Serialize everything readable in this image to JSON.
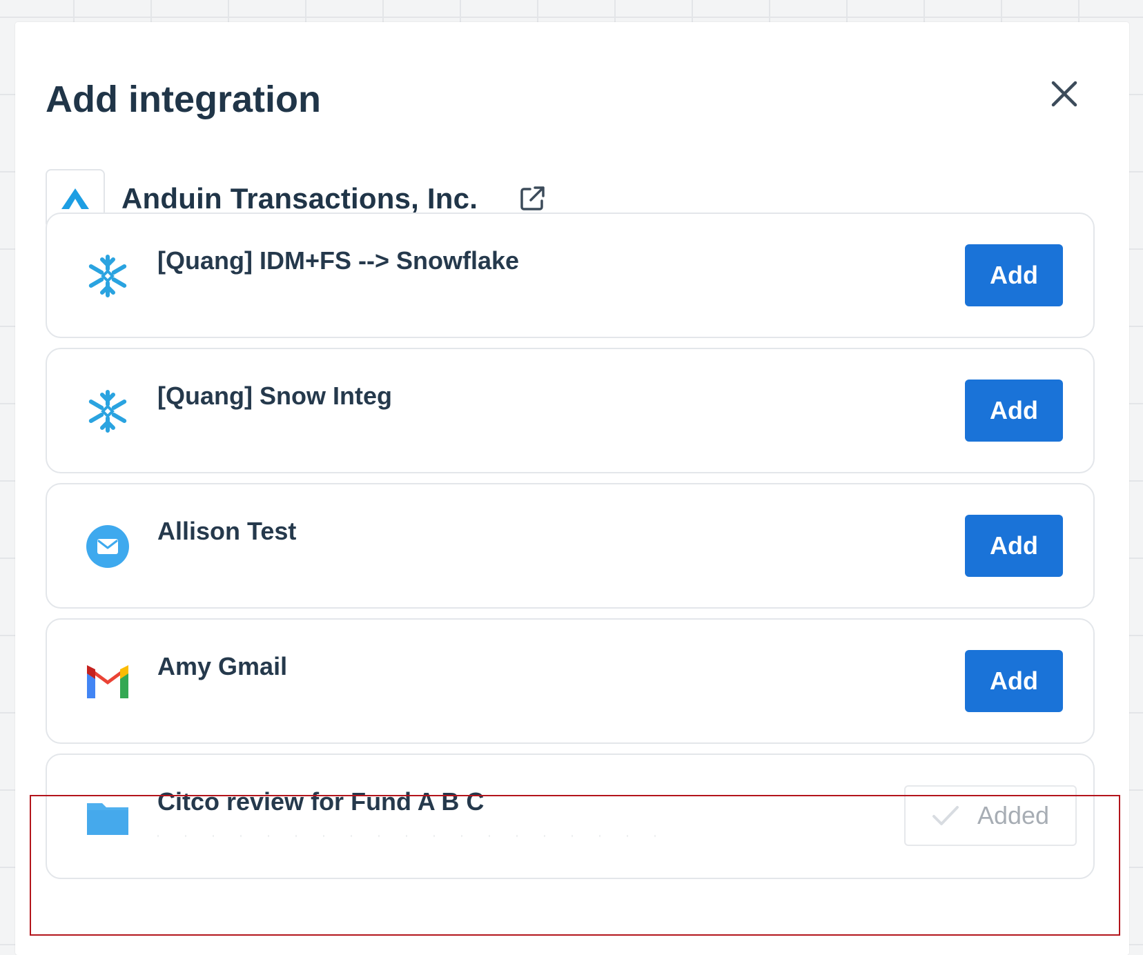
{
  "dialog": {
    "title": "Add integration",
    "close_icon": "close-icon",
    "accent_color": "#1a73d8",
    "highlight_color": "#b3141b"
  },
  "organization": {
    "name": "Anduin Transactions, Inc.",
    "logo_icon": "anduin-logo-icon",
    "link_icon": "external-link-icon"
  },
  "integrations": [
    {
      "name": "[Quang] IDM+FS --> Snowflake",
      "icon": "snowflake-icon",
      "action": "Add",
      "status": "not-added"
    },
    {
      "name": "[Quang] Snow Integ",
      "icon": "snowflake-icon",
      "action": "Add",
      "status": "not-added"
    },
    {
      "name": "Allison Test",
      "icon": "email-icon",
      "action": "Add",
      "status": "not-added"
    },
    {
      "name": "Amy Gmail",
      "icon": "gmail-icon",
      "action": "Add",
      "status": "not-added"
    },
    {
      "name": "Citco review for Fund A B C",
      "icon": "folder-icon",
      "action": "Added",
      "status": "added",
      "action_icon": "check-icon"
    }
  ]
}
